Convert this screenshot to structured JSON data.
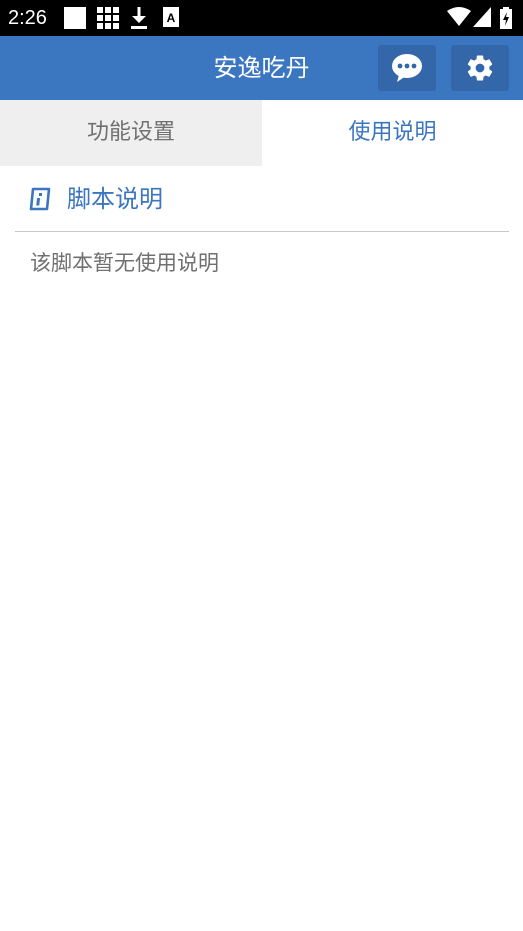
{
  "status_bar": {
    "time": "2:26",
    "icons": [
      "blank-notification-icon",
      "grid-app-icon",
      "download-icon",
      "font-a-icon",
      "wifi-icon",
      "signal-icon",
      "battery-charging-icon"
    ]
  },
  "app_bar": {
    "title": "安逸吃丹",
    "chat_icon": "chat-bubble-icon",
    "settings_icon": "gear-icon",
    "background_color": "#3b76c0"
  },
  "tabs": [
    {
      "label": "功能设置",
      "active": false
    },
    {
      "label": "使用说明",
      "active": true
    }
  ],
  "section": {
    "icon": "info-icon",
    "title": "脚本说明",
    "body": "该脚本暂无使用说明"
  },
  "colors": {
    "accent": "#3b76c0",
    "button_bg": "#3466aa",
    "inactive_tab_bg": "#efefef",
    "muted_text": "#707070"
  }
}
